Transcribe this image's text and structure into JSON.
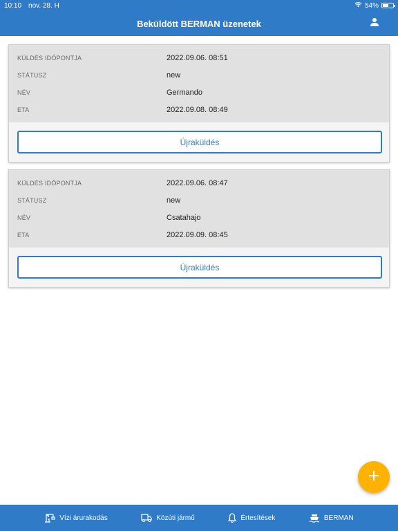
{
  "status_bar": {
    "time": "10:10",
    "date": "nov. 28. H",
    "battery": "54%",
    "battery_level": 0.54
  },
  "header": {
    "title": "Beküldött BERMAN üzenetek",
    "user_icon": "user-icon"
  },
  "cards": [
    {
      "fields": [
        {
          "label": "KÜLDÉS IDŐPONTJA",
          "value": "2022.09.06. 08:51"
        },
        {
          "label": "STÁTUSZ",
          "value": "new"
        },
        {
          "label": "NÉV",
          "value": "Germando"
        },
        {
          "label": "ETA",
          "value": "2022.09.08. 08:49"
        }
      ],
      "button_label": "Újraküldés"
    },
    {
      "fields": [
        {
          "label": "KÜLDÉS IDŐPONTJA",
          "value": "2022.09.06. 08:47"
        },
        {
          "label": "STÁTUSZ",
          "value": "new"
        },
        {
          "label": "NÉV",
          "value": "Csatahajo"
        },
        {
          "label": "ETA",
          "value": "2022.09.09. 08:45"
        }
      ],
      "button_label": "Újraküldés"
    }
  ],
  "fab": {
    "icon": "plus-icon"
  },
  "tabs": [
    {
      "label": "Vízi árurakodás",
      "icon": "crane-icon"
    },
    {
      "label": "Közúti jármű",
      "icon": "truck-icon"
    },
    {
      "label": "Értesítések",
      "icon": "bell-icon"
    },
    {
      "label": "BERMAN",
      "icon": "ship-icon"
    }
  ],
  "colors": {
    "primary": "#2f7bc8",
    "fab": "#ffb300",
    "card_header": "#e1e1e1",
    "card_body": "#f4f4f4"
  }
}
